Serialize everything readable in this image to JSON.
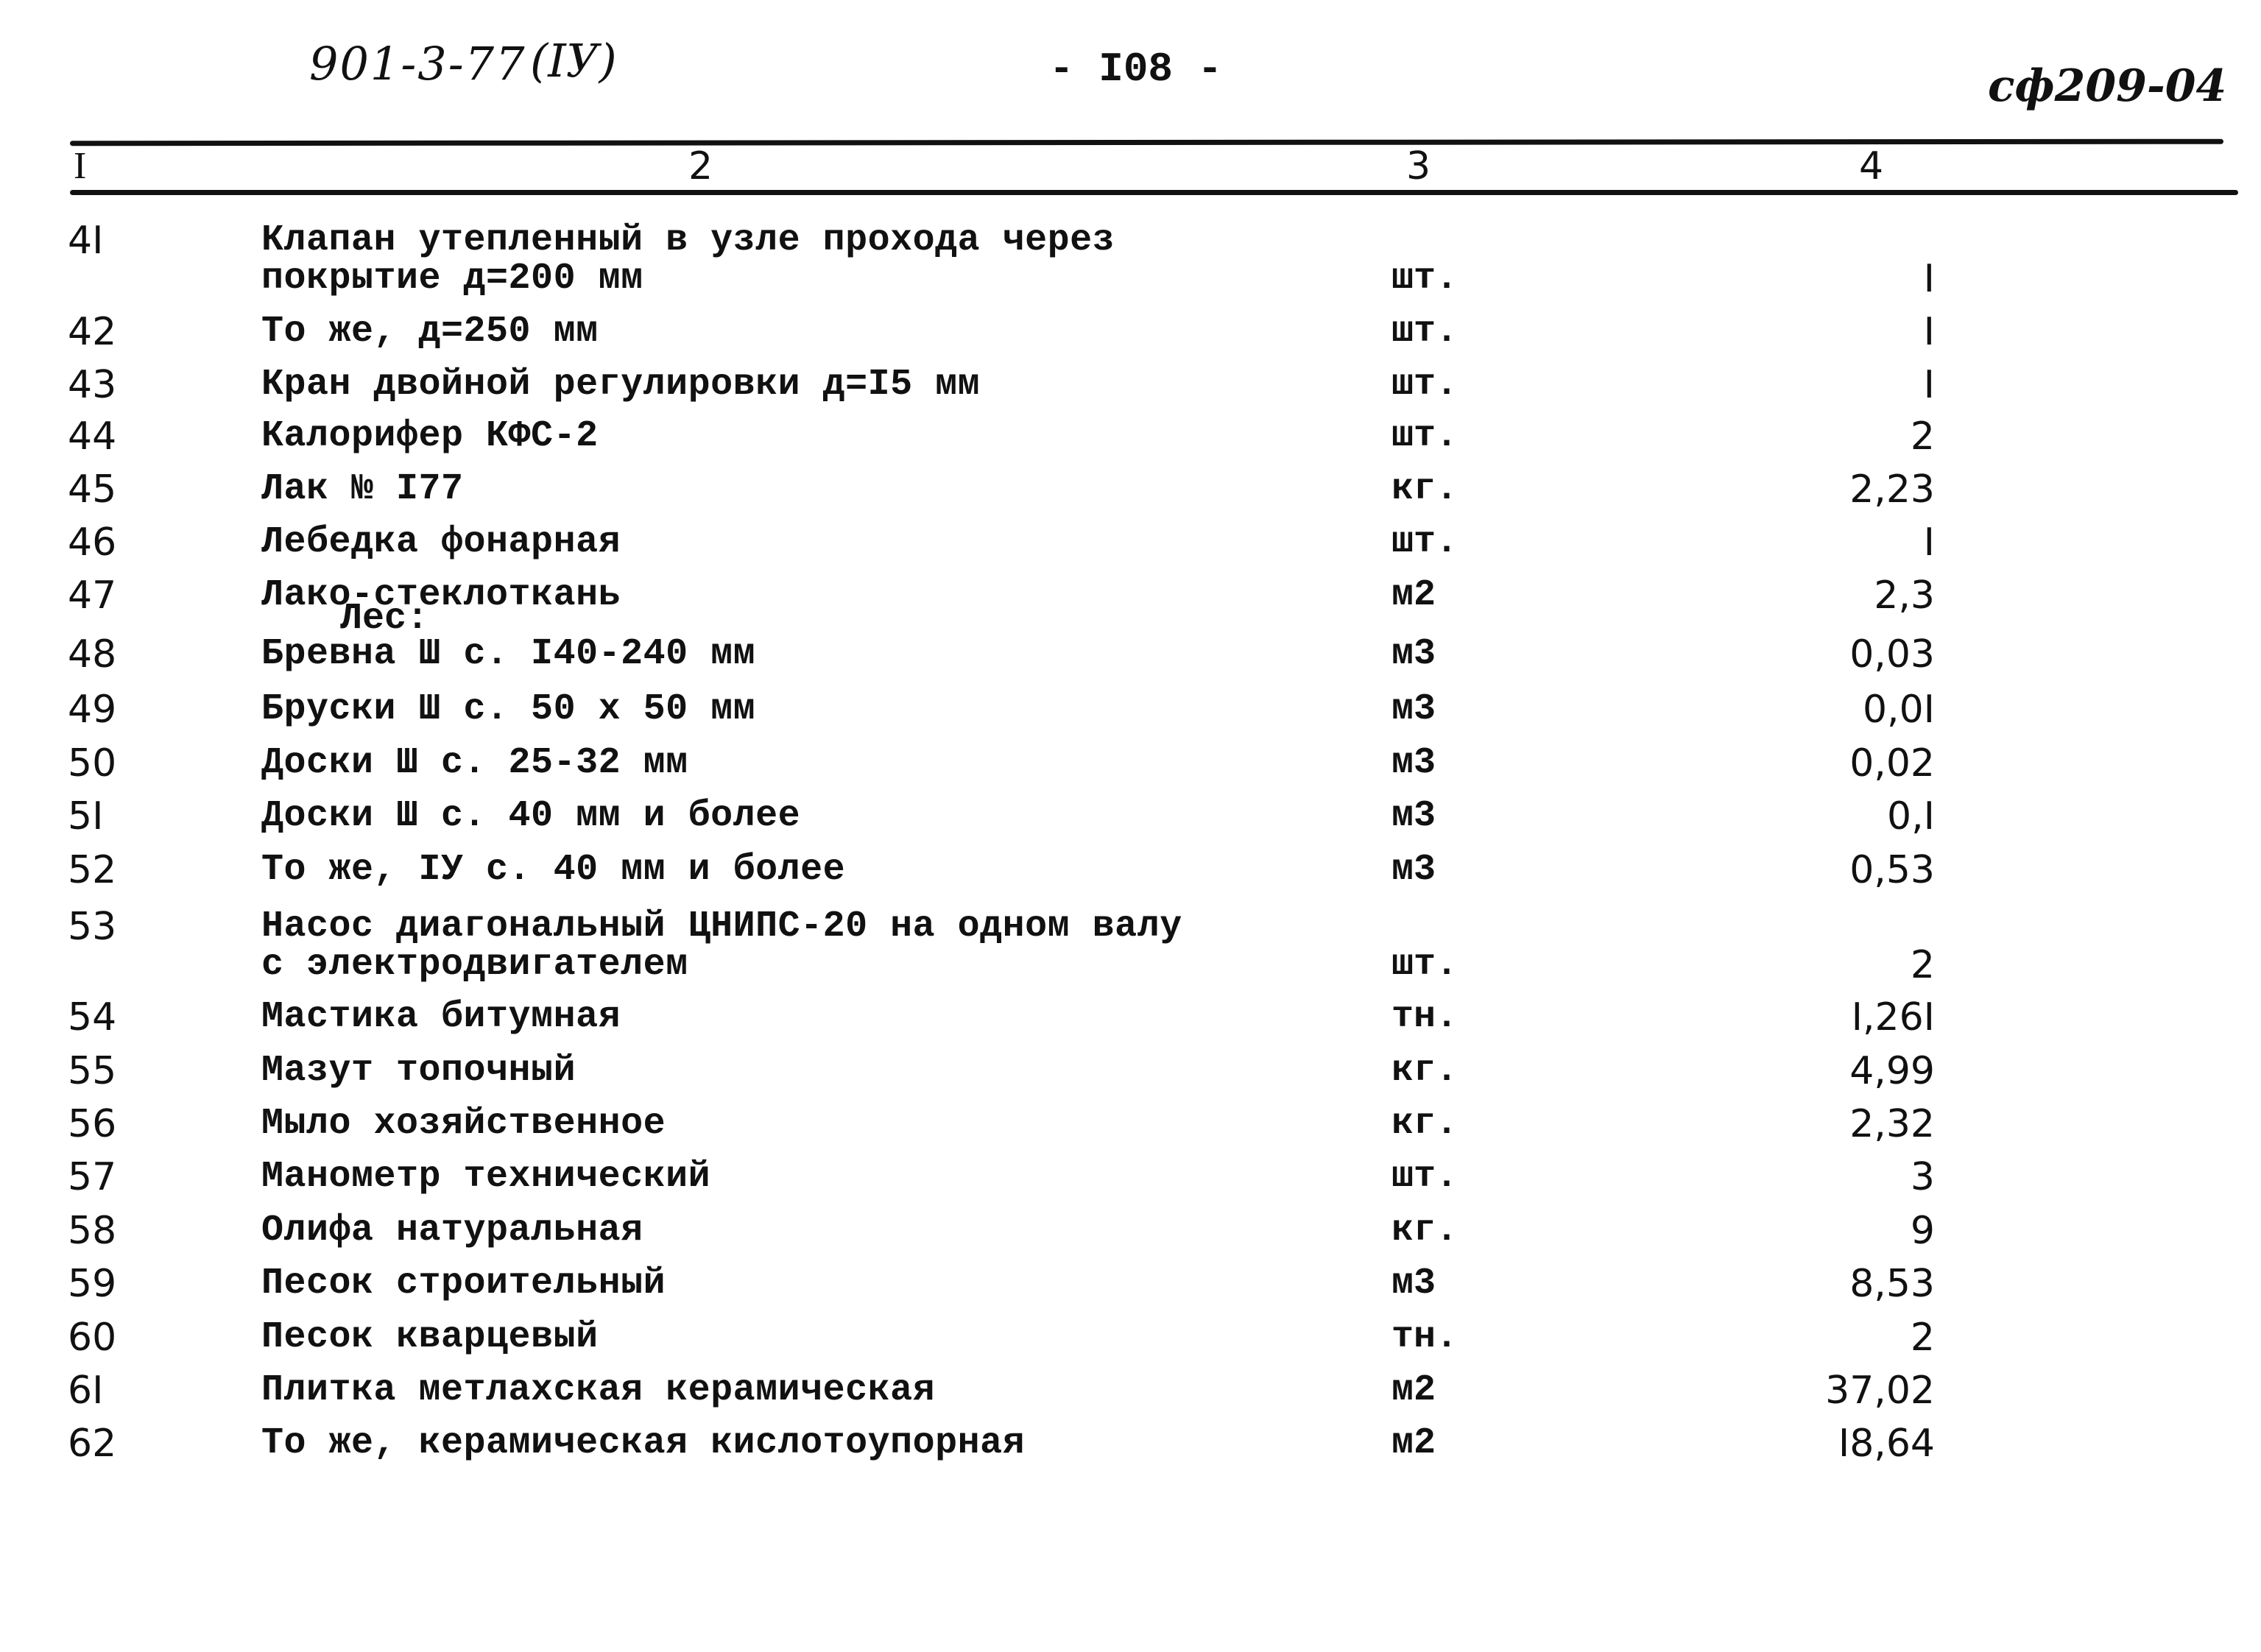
{
  "header": {
    "doc_code": "901-3-77",
    "volume": "(IУ)",
    "page_number": "- I08 -",
    "sheet_code": "сф209-04"
  },
  "table": {
    "columns": [
      "I",
      "2",
      "3",
      "4"
    ],
    "section_label": "Лес:",
    "rows": [
      {
        "no": "4I",
        "desc": [
          "Клапан утепленный в узле прохода через",
          "покрытие д=200 мм"
        ],
        "unit": "шт.",
        "qty": "I"
      },
      {
        "no": "42",
        "desc": [
          "То же, д=250 мм"
        ],
        "unit": "шт.",
        "qty": "I"
      },
      {
        "no": "43",
        "desc": [
          "Кран двойной регулировки д=I5 мм"
        ],
        "unit": "шт.",
        "qty": "I"
      },
      {
        "no": "44",
        "desc": [
          "Калорифер КФС-2"
        ],
        "unit": "шт.",
        "qty": "2"
      },
      {
        "no": "45",
        "desc": [
          "Лак № I77"
        ],
        "unit": "кг.",
        "qty": "2,23"
      },
      {
        "no": "46",
        "desc": [
          "Лебедка фонарная"
        ],
        "unit": "шт.",
        "qty": "I"
      },
      {
        "no": "47",
        "desc": [
          "Лако-стеклоткань"
        ],
        "unit": "м2",
        "qty": "2,3"
      },
      {
        "no": "48",
        "desc": [
          "Бревна Ш с. I40-240 мм"
        ],
        "unit": "м3",
        "qty": "0,03"
      },
      {
        "no": "49",
        "desc": [
          "Бруски Ш с. 50 х 50 мм"
        ],
        "unit": "м3",
        "qty": "0,0I"
      },
      {
        "no": "50",
        "desc": [
          "Доски Ш с. 25-32 мм"
        ],
        "unit": "м3",
        "qty": "0,02"
      },
      {
        "no": "5I",
        "desc": [
          "Доски Ш с. 40 мм и более"
        ],
        "unit": "м3",
        "qty": "0,I"
      },
      {
        "no": "52",
        "desc": [
          "То же, IУ с. 40 мм и более"
        ],
        "unit": "м3",
        "qty": "0,53"
      },
      {
        "no": "53",
        "desc": [
          "Насос диагональный ЦНИПС-20 на одном валу",
          "с электродвигателем"
        ],
        "unit": "шт.",
        "qty": "2"
      },
      {
        "no": "54",
        "desc": [
          "Мастика битумная"
        ],
        "unit": "тн.",
        "qty": "I,26I"
      },
      {
        "no": "55",
        "desc": [
          "Мазут топочный"
        ],
        "unit": "кг.",
        "qty": "4,99"
      },
      {
        "no": "56",
        "desc": [
          "Мыло хозяйственное"
        ],
        "unit": "кг.",
        "qty": "2,32"
      },
      {
        "no": "57",
        "desc": [
          "Манометр технический"
        ],
        "unit": "шт.",
        "qty": "3"
      },
      {
        "no": "58",
        "desc": [
          "Олифа натуральная"
        ],
        "unit": "кг.",
        "qty": "9"
      },
      {
        "no": "59",
        "desc": [
          "Песок строительный"
        ],
        "unit": "м3",
        "qty": "8,53"
      },
      {
        "no": "60",
        "desc": [
          "Песок кварцевый"
        ],
        "unit": "тн.",
        "qty": "2"
      },
      {
        "no": "6I",
        "desc": [
          "Плитка метлахская керамическая"
        ],
        "unit": "м2",
        "qty": "37,02"
      },
      {
        "no": "62",
        "desc": [
          "То же, керамическая кислотоупорная"
        ],
        "unit": "м2",
        "qty": "I8,64"
      }
    ]
  }
}
